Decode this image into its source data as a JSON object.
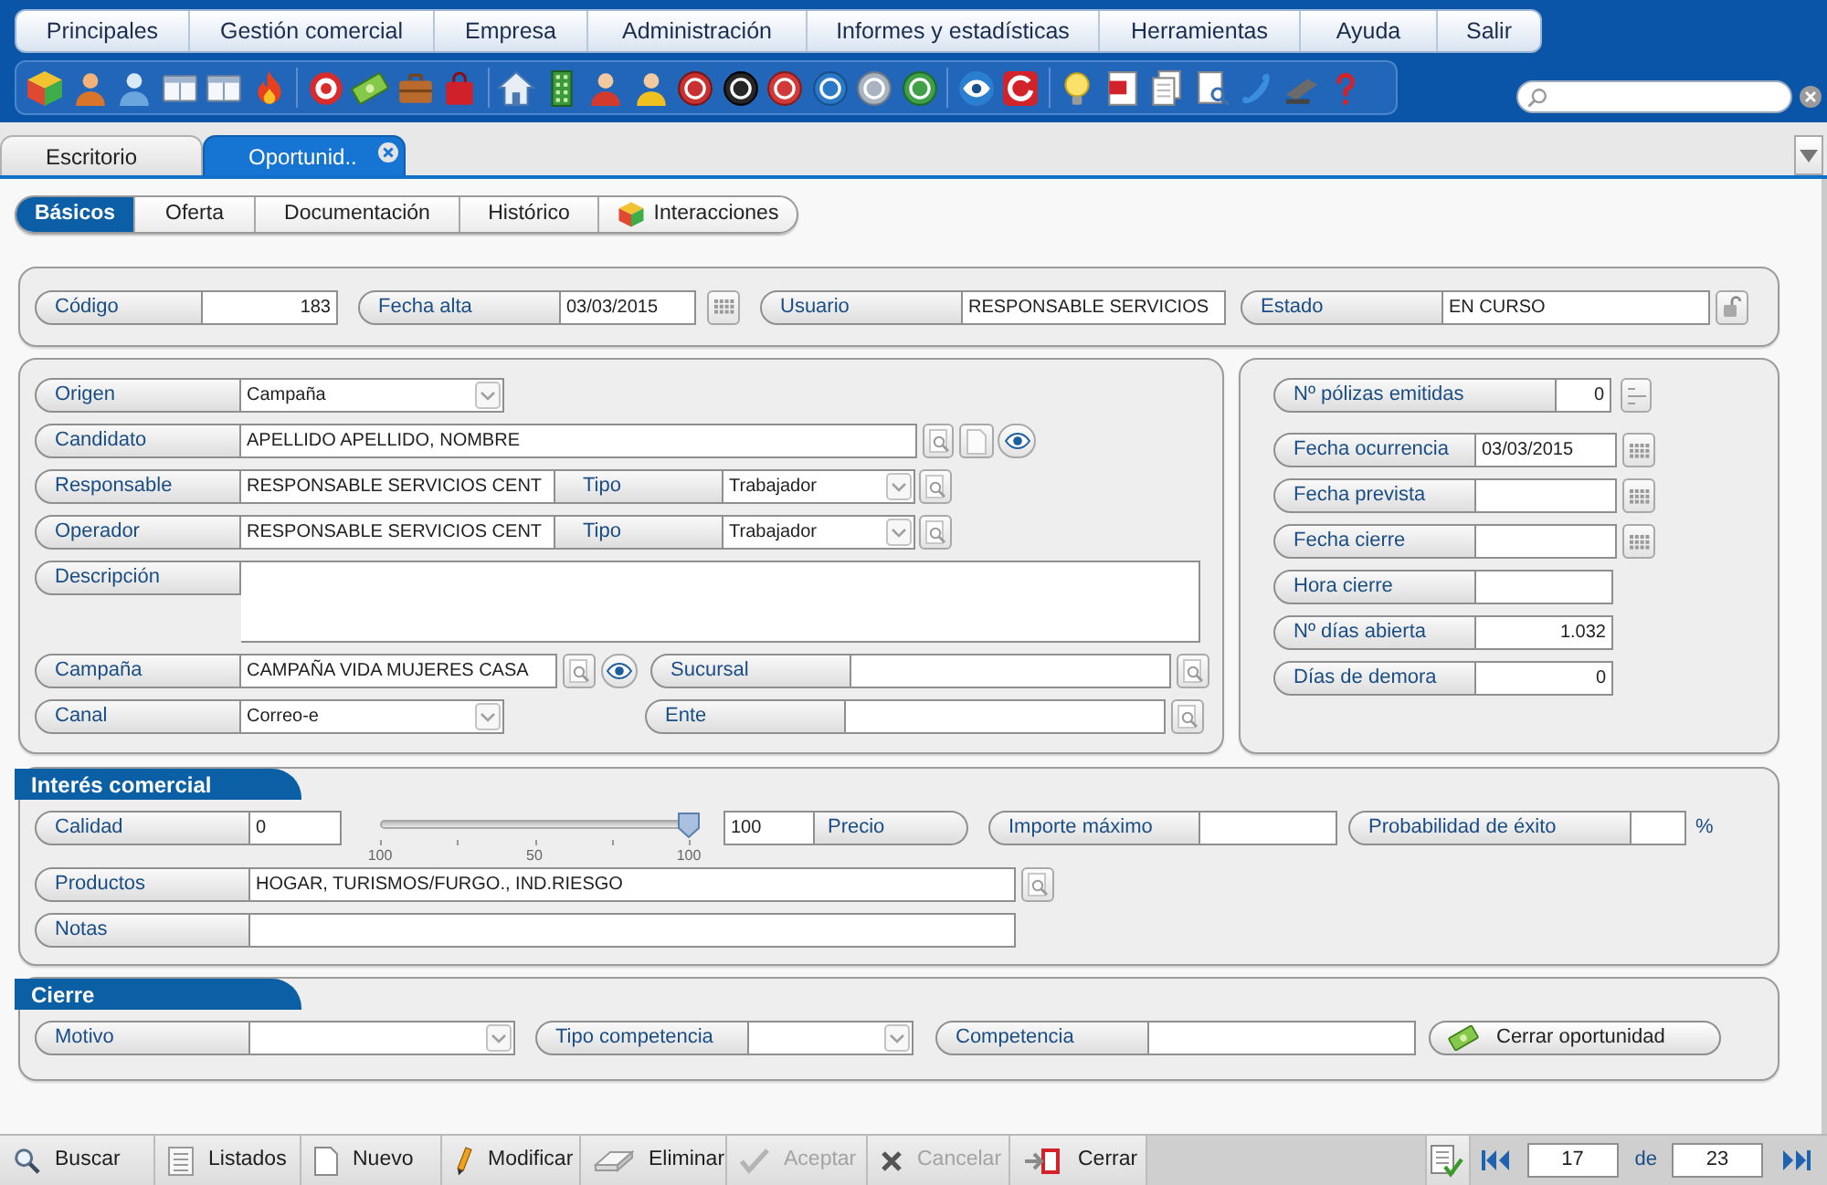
{
  "menu": [
    "Principales",
    "Gestión comercial",
    "Empresa",
    "Administración",
    "Informes y estadísticas",
    "Herramientas",
    "Ayuda",
    "Salir"
  ],
  "doc_tabs": [
    {
      "label": "Escritorio",
      "selected": false,
      "closable": false
    },
    {
      "label": "Oportunid..",
      "selected": true,
      "closable": true
    }
  ],
  "sub_tabs": [
    {
      "label": "Básicos",
      "selected": true,
      "kind": "text"
    },
    {
      "label": "Oferta",
      "selected": false,
      "kind": "text"
    },
    {
      "label": "Documentación",
      "selected": false,
      "kind": "text"
    },
    {
      "label": "Histórico",
      "selected": false,
      "kind": "text"
    },
    {
      "label": "Interacciones",
      "selected": false,
      "kind": "icon"
    }
  ],
  "record": {
    "code": {
      "label": "Código",
      "value": "183"
    },
    "created": {
      "label": "Fecha alta",
      "value": "03/03/2015"
    },
    "user": {
      "label": "Usuario",
      "value": "RESPONSABLE SERVICIOS"
    },
    "status": {
      "label": "Estado",
      "value": "EN CURSO"
    }
  },
  "details": {
    "origin": {
      "label": "Origen",
      "value": "Campaña"
    },
    "candidate": {
      "label": "Candidato",
      "value": "APELLIDO APELLIDO, NOMBRE"
    },
    "responsible": {
      "label": "Responsable",
      "value": "RESPONSABLE SERVICIOS CENT",
      "type_label": "Tipo",
      "type_value": "Trabajador"
    },
    "operator": {
      "label": "Operador",
      "value": "RESPONSABLE SERVICIOS CENT",
      "type_label": "Tipo",
      "type_value": "Trabajador"
    },
    "description": {
      "label": "Descripción"
    },
    "campaign": {
      "label": "Campaña",
      "value": "CAMPAÑA VIDA MUJERES CASA"
    },
    "branch": {
      "label": "Sucursal"
    },
    "channel": {
      "label": "Canal",
      "value": "Correo-e"
    },
    "entity": {
      "label": "Ente"
    }
  },
  "indicators": [
    {
      "label": "Nº pólizas emitidas",
      "value": "0",
      "kind": "counter"
    },
    {
      "label": "Fecha ocurrencia",
      "value": "03/03/2015",
      "kind": "date"
    },
    {
      "label": "Fecha prevista",
      "kind": "date"
    },
    {
      "label": "Fecha cierre",
      "kind": "date"
    },
    {
      "label": "Hora cierre",
      "kind": "text"
    },
    {
      "label": "Nº días abierta",
      "value": "1.032",
      "kind": "number"
    },
    {
      "label": "Días de demora",
      "value": "0",
      "kind": "number"
    }
  ],
  "interest": {
    "title": "Interés comercial",
    "quality": {
      "label": "Calidad",
      "value": "0"
    },
    "slider": {
      "level": 1,
      "tick_labels": [
        "100",
        "50",
        "100"
      ],
      "value": "100"
    },
    "price": {
      "label": "Precio"
    },
    "max_amount": {
      "label": "Importe máximo"
    },
    "probability": {
      "label": "Probabilidad de éxito",
      "unit": "%"
    },
    "products": {
      "label": "Productos",
      "value": "HOGAR, TURISMOS/FURGO., IND.RIESGO"
    },
    "notes": {
      "label": "Notas"
    }
  },
  "closing": {
    "title": "Cierre",
    "reason": {
      "label": "Motivo"
    },
    "competition_type": {
      "label": "Tipo competencia"
    },
    "competitor": {
      "label": "Competencia"
    },
    "close_button": "Cerrar oportunidad"
  },
  "actions": [
    {
      "label": "Buscar",
      "disabled": false
    },
    {
      "label": "Listados",
      "disabled": false
    },
    {
      "label": "Nuevo",
      "disabled": false
    },
    {
      "label": "Modificar",
      "disabled": false
    },
    {
      "label": "Eliminar",
      "disabled": false
    },
    {
      "label": "Aceptar",
      "disabled": true
    },
    {
      "label": "Cancelar",
      "disabled": true
    },
    {
      "label": "Cerrar",
      "disabled": false
    }
  ],
  "pager": {
    "current": "17",
    "separator": "de",
    "total": "23"
  }
}
